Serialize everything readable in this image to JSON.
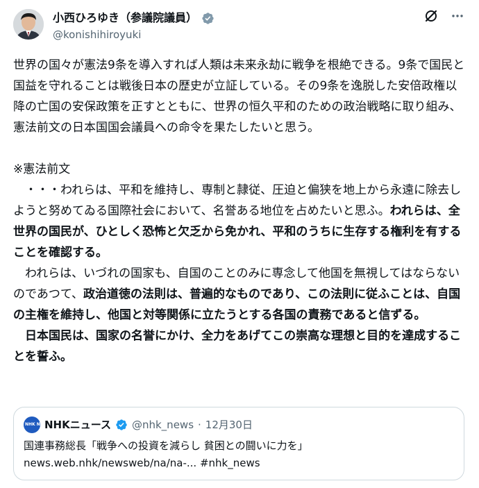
{
  "author": {
    "name": "小西ひろゆき（参議院議員）",
    "handle": "@konishihiroyuki"
  },
  "icons": {
    "verified": "verified-badge-icon",
    "grok": "grok-icon",
    "more": "more-icon"
  },
  "colors": {
    "verified_gray": "#829aab",
    "verified_blue": "#1d9bf0",
    "secondary_text": "#536471",
    "border": "#cfd9de"
  },
  "tweet": {
    "p1": "世界の国々が憲法9条を導入すれば人類は未来永劫に戦争を根絶できる。9条で国民と国益を守れることは戦後日本の歴史が立証している。その9条を逸脱した安倍政権以降の亡国の安保政策を正すとともに、世界の恒久平和のための政治戦略に取り組み、憲法前文の日本国国会議員への命令を果たしたいと思う。",
    "p2": "※憲法前文",
    "p3_normal": "　・・・われらは、平和を維持し、専制と隷従、圧迫と偏狭を地上から永遠に除去しようと努めてゐる国際社会において、名誉ある地位を占めたいと思ふ。",
    "p3_bold": "われらは、全世界の国民が、ひとしく恐怖と欠乏から免かれ、平和のうちに生存する権利を有することを確認する。",
    "p4_normal": "　われらは、いづれの国家も、自国のことのみに専念して他国を無視してはならないのであつて、",
    "p4_bold": "政治道徳の法則は、普遍的なものであり、この法則に従ふことは、自国の主権を維持し、他国と対等関係に立たうとする各国の責務であると信ずる。",
    "p5_bold": "　日本国民は、国家の名誉にかけ、全力をあげてこの崇高な理想と目的を達成することを誓ふ。"
  },
  "quote": {
    "avatar_text": "NHK NEWS",
    "name": "NHKニュース",
    "handle": "@nhk_news",
    "separator": "·",
    "date": "12月30日",
    "line1": "国連事務総長「戦争への投資を減らし 貧困との闘いに力を」",
    "line2": "news.web.nhk/newsweb/na/na-... #nhk_news"
  }
}
